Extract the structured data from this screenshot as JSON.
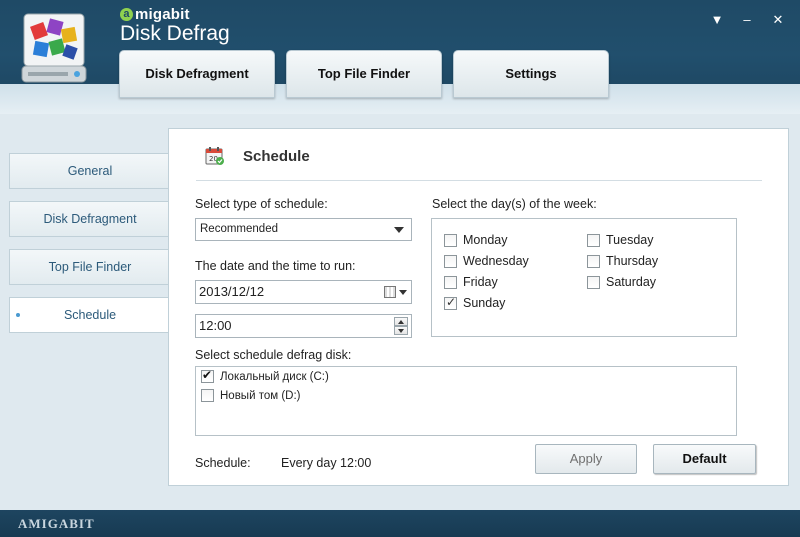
{
  "header": {
    "brand": "migabit",
    "brand_initial": "a",
    "title": "Disk Defrag",
    "controls": [
      "▼",
      "–",
      "✕"
    ]
  },
  "tabs": [
    {
      "label": "Disk Defragment"
    },
    {
      "label": "Top File Finder"
    },
    {
      "label": "Settings"
    }
  ],
  "sidebar": {
    "items": [
      {
        "label": "General",
        "active": false
      },
      {
        "label": "Disk Defragment",
        "active": false
      },
      {
        "label": "Top File Finder",
        "active": false
      },
      {
        "label": "Schedule",
        "active": true
      }
    ]
  },
  "schedule": {
    "title": "Schedule",
    "icon": "calendar-icon",
    "type_label": "Select type of schedule:",
    "type_value": "Recommended",
    "datetime_label": "The date and the time to run:",
    "date_value": "2013/12/12",
    "time_value": "12:00",
    "days_label": "Select the day(s) of the week:",
    "days": [
      {
        "label": "Monday",
        "checked": false
      },
      {
        "label": "Tuesday",
        "checked": false
      },
      {
        "label": "Wednesday",
        "checked": false
      },
      {
        "label": "Thursday",
        "checked": false
      },
      {
        "label": "Friday",
        "checked": false
      },
      {
        "label": "Saturday",
        "checked": false
      },
      {
        "label": "Sunday",
        "checked": true
      }
    ],
    "disk_label": "Select schedule defrag disk:",
    "disks": [
      {
        "label": "Локальный диск (C:)",
        "checked": true
      },
      {
        "label": "Новый том (D:)",
        "checked": false
      }
    ],
    "summary_label": "Schedule:",
    "summary_value": "Every day 12:00",
    "apply_label": "Apply",
    "default_label": "Default"
  },
  "footer": {
    "logo": "AMIGABIT"
  },
  "colors": {
    "header_bg": "#1f4a66",
    "panel_bg": "#ffffff",
    "main_bg": "#dfe9ef",
    "accent_link": "#2c5a7a"
  }
}
